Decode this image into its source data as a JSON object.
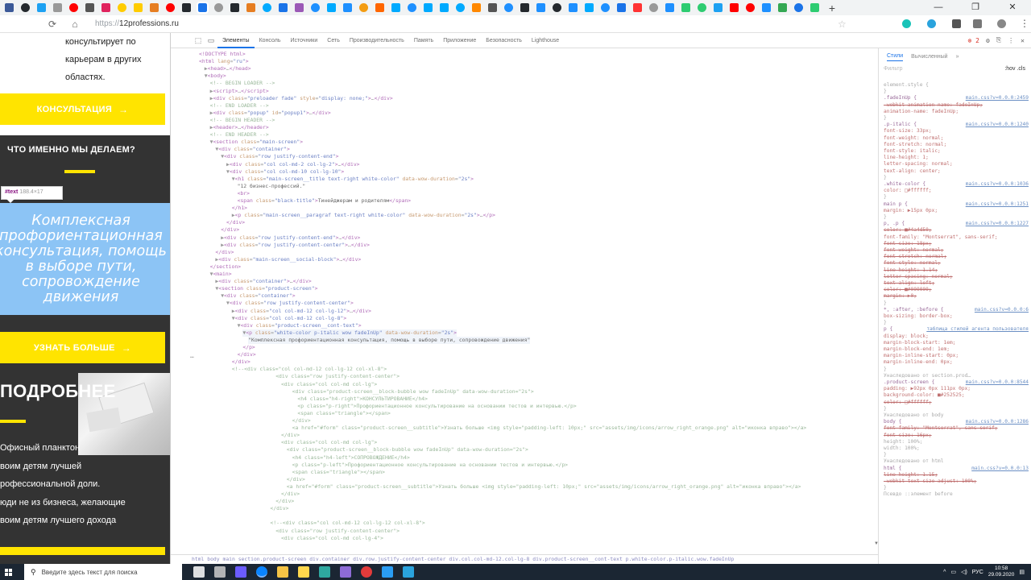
{
  "browser": {
    "url_scheme": "https://",
    "url_host": "12professions.ru",
    "tab_icon_colors": [
      "#3b5998",
      "#24292e",
      "#1da1f2",
      "#999999",
      "#ff0000",
      "#555555",
      "#e0245e",
      "#ffcc00",
      "#ffcc00",
      "#e67e22",
      "#ff0000",
      "#24292e",
      "#1a73e8",
      "#999999",
      "#24292e",
      "#e67e22",
      "#00aaff",
      "#1a73e8",
      "#9b59b6",
      "#1e90ff",
      "#00aaff",
      "#1e90ff",
      "#f39c12",
      "#ff6600",
      "#00aaff",
      "#1e90ff",
      "#00aaff",
      "#00aaff",
      "#00aaff",
      "#ff8800",
      "#555555",
      "#1e90ff",
      "#24292e",
      "#1e90ff",
      "#24292e",
      "#1e90ff",
      "#00aaff",
      "#1e90ff",
      "#1a73e8",
      "#ff3333",
      "#999999",
      "#1e90ff",
      "#2ecc71",
      "#2ecc71",
      "#1da1f2",
      "#ff0000",
      "#ff0000",
      "#1e90ff",
      "#34a853",
      "#1a73e8",
      "#2ecc71"
    ],
    "window_controls": [
      "—",
      "❐",
      "✕"
    ],
    "new_tab": "+"
  },
  "site": {
    "intro_text": "консультирует по карьерам в других областях.",
    "consult_button": "КОНСУЛЬТАЦИЯ",
    "what_we_do_title": "ЧТО ИМЕННО МЫ ДЕЛАЕМ?",
    "inspect_tooltip_tag": "#text",
    "inspect_tooltip_size": "188.4×17",
    "highlight_text": "Комплексная профориентационная консультация, помощь в выборе пути, сопровождение движения",
    "learn_more_button": "УЗНАТЬ БОЛЬШЕ",
    "details_title": "ПОДРОБНЕЕ",
    "details_lines": [
      "Офисный планктон",
      "воим детям лучшей",
      "рофессиональной доли.",
      "юди не из бизнеса, желающие",
      "воим детям лучшего дохода"
    ],
    "arrow": "→"
  },
  "devtools": {
    "tabs": [
      "Элементы",
      "Консоль",
      "Источники",
      "Сеть",
      "Производительность",
      "Память",
      "Приложение",
      "Безопасность",
      "Lighthouse"
    ],
    "active_tab": "Элементы",
    "error_count": "2",
    "dom_lines": [
      {
        "indent": 0,
        "html": "<span class='t'>&lt;!DOCTYPE html&gt;</span>"
      },
      {
        "indent": 0,
        "html": "<span class='t'>&lt;html</span> <span class='a'>lang</span>=<span class='v'>\"ru\"</span><span class='t'>&gt;</span>"
      },
      {
        "indent": 1,
        "html": "▶<span class='t'>&lt;head&gt;</span>…<span class='t'>&lt;/head&gt;</span>"
      },
      {
        "indent": 1,
        "html": "▼<span class='t'>&lt;body&gt;</span>"
      },
      {
        "indent": 2,
        "html": "<span class='c'>&lt;!-- BEGIN LOADER --&gt;</span>"
      },
      {
        "indent": 2,
        "html": "▶<span class='t'>&lt;script&gt;</span>…<span class='t'>&lt;/script&gt;</span>"
      },
      {
        "indent": 2,
        "html": "▶<span class='t'>&lt;div</span> <span class='a'>class</span>=<span class='v'>\"preloader fade\"</span> <span class='a'>style</span>=<span class='v'>\"display: none;\"</span><span class='t'>&gt;</span>…<span class='t'>&lt;/div&gt;</span>"
      },
      {
        "indent": 2,
        "html": "<span class='c'>&lt;!-- END LOADER --&gt;</span>"
      },
      {
        "indent": 2,
        "html": "▶<span class='t'>&lt;div</span> <span class='a'>class</span>=<span class='v'>\"popup\"</span> <span class='a'>id</span>=<span class='v'>\"popup1\"</span><span class='t'>&gt;</span>…<span class='t'>&lt;/div&gt;</span>"
      },
      {
        "indent": 2,
        "html": "<span class='c'>&lt;!-- BEGIN HEADER --&gt;</span>"
      },
      {
        "indent": 2,
        "html": "▶<span class='t'>&lt;header&gt;</span>…<span class='t'>&lt;/header&gt;</span>"
      },
      {
        "indent": 2,
        "html": "<span class='c'>&lt;!-- END HEADER --&gt;</span>"
      },
      {
        "indent": 2,
        "html": "▼<span class='t'>&lt;section</span> <span class='a'>class</span>=<span class='v'>\"main-screen\"</span><span class='t'>&gt;</span>"
      },
      {
        "indent": 3,
        "html": "▼<span class='t'>&lt;div</span> <span class='a'>class</span>=<span class='v'>\"container\"</span><span class='t'>&gt;</span>"
      },
      {
        "indent": 4,
        "html": "▼<span class='t'>&lt;div</span> <span class='a'>class</span>=<span class='v'>\"row justify-content-end\"</span><span class='t'>&gt;</span>"
      },
      {
        "indent": 5,
        "html": "▶<span class='t'>&lt;div</span> <span class='a'>class</span>=<span class='v'>\"col col-md-2 col-lg-2\"</span><span class='t'>&gt;</span>…<span class='t'>&lt;/div&gt;</span>"
      },
      {
        "indent": 5,
        "html": "▼<span class='t'>&lt;div</span> <span class='a'>class</span>=<span class='v'>\"col col-md-10 col-lg-10\"</span><span class='t'>&gt;</span>"
      },
      {
        "indent": 6,
        "html": "▼<span class='t'>&lt;h1</span> <span class='a'>class</span>=<span class='v'>\"main-screen__title text-right white-color\"</span> <span class='a'>data-wow-duration</span>=<span class='v'>\"2s\"</span><span class='t'>&gt;</span>"
      },
      {
        "indent": 7,
        "html": "<span class='tx'>\"12 бизнес-профессий.\"</span>"
      },
      {
        "indent": 7,
        "html": "<span class='t'>&lt;br&gt;</span>"
      },
      {
        "indent": 7,
        "html": "<span class='t'>&lt;span</span> <span class='a'>class</span>=<span class='v'>\"black-title\"</span><span class='t'>&gt;</span><span class='tx'>Тинейджерам и родителям</span><span class='t'>&lt;/span&gt;</span>"
      },
      {
        "indent": 6,
        "html": "<span class='t'>&lt;/h1&gt;</span>"
      },
      {
        "indent": 6,
        "html": "▶<span class='t'>&lt;p</span> <span class='a'>class</span>=<span class='v'>\"main-screen__paragraf text-right white-color\"</span> <span class='a'>data-wow-duration</span>=<span class='v'>\"2s\"</span><span class='t'>&gt;</span>…<span class='t'>&lt;/p&gt;</span>"
      },
      {
        "indent": 5,
        "html": "<span class='t'>&lt;/div&gt;</span>"
      },
      {
        "indent": 4,
        "html": "<span class='t'>&lt;/div&gt;</span>"
      },
      {
        "indent": 4,
        "html": "▶<span class='t'>&lt;div</span> <span class='a'>class</span>=<span class='v'>\"row justify-content-end\"</span><span class='t'>&gt;</span>…<span class='t'>&lt;/div&gt;</span>"
      },
      {
        "indent": 4,
        "html": "▶<span class='t'>&lt;div</span> <span class='a'>class</span>=<span class='v'>\"row justify-content-center\"</span><span class='t'>&gt;</span>…<span class='t'>&lt;/div&gt;</span>"
      },
      {
        "indent": 3,
        "html": "<span class='t'>&lt;/div&gt;</span>"
      },
      {
        "indent": 3,
        "html": "▶<span class='t'>&lt;div</span> <span class='a'>class</span>=<span class='v'>\"main-screen__social-block\"</span><span class='t'>&gt;</span>…<span class='t'>&lt;/div&gt;</span>"
      },
      {
        "indent": 2,
        "html": "<span class='t'>&lt;/section&gt;</span>"
      },
      {
        "indent": 2,
        "html": "▼<span class='t'>&lt;main&gt;</span>"
      },
      {
        "indent": 3,
        "html": "▶<span class='t'>&lt;div</span> <span class='a'>class</span>=<span class='v'>\"container\"</span><span class='t'>&gt;</span>…<span class='t'>&lt;/div&gt;</span>"
      },
      {
        "indent": 3,
        "html": "▼<span class='t'>&lt;section</span> <span class='a'>class</span>=<span class='v'>\"product-screen\"</span><span class='t'>&gt;</span>"
      },
      {
        "indent": 4,
        "html": "▼<span class='t'>&lt;div</span> <span class='a'>class</span>=<span class='v'>\"container\"</span><span class='t'>&gt;</span>"
      },
      {
        "indent": 5,
        "html": "▼<span class='t'>&lt;div</span> <span class='a'>class</span>=<span class='v'>\"row justify-content-center\"</span><span class='t'>&gt;</span>"
      },
      {
        "indent": 6,
        "html": "▶<span class='t'>&lt;div</span> <span class='a'>class</span>=<span class='v'>\"col col-md-12 col-lg-12\"</span><span class='t'>&gt;</span>…<span class='t'>&lt;/div&gt;</span>"
      },
      {
        "indent": 6,
        "html": "▼<span class='t'>&lt;div</span> <span class='a'>class</span>=<span class='v'>\"col col-md-12 col-lg-8\"</span><span class='t'>&gt;</span>"
      },
      {
        "indent": 7,
        "html": "▼<span class='t'>&lt;div</span> <span class='a'>class</span>=<span class='v'>\"product-screen__cont-text\"</span><span class='t'>&gt;</span>"
      },
      {
        "indent": 8,
        "html": "▼<span class='t'>&lt;p</span> <span class='a'>class</span>=<span class='v'>\"white-color p-italic wow fadeInUp\"</span> <span class='a'>data-wow-duration</span>=<span class='v'>\"2s\"</span><span class='t'>&gt;</span>",
        "sel": true
      },
      {
        "indent": 9,
        "html": "<span class='tx'>\"Комплексная профориентационная консультация, помощь в выборе пути, сопровождение движения\"</span>",
        "sel": true
      },
      {
        "indent": 8,
        "html": "<span class='t'>&lt;/p&gt;</span>"
      },
      {
        "indent": 7,
        "html": "<span class='t'>&lt;/div&gt;</span>"
      },
      {
        "indent": 6,
        "html": "<span class='t'>&lt;/div&gt;</span>"
      },
      {
        "indent": 6,
        "html": "<span class='c'>&lt;!--&lt;div class=\"col col-md-12 col-lg-12 col-xl-8\"&gt;</span>"
      },
      {
        "indent": 14,
        "html": "<span class='c'>&lt;div class=\"row justify-content-center\"&gt;</span>"
      },
      {
        "indent": 15,
        "html": "<span class='c'>&lt;div class=\"col col-md col-lg\"&gt;</span>"
      },
      {
        "indent": 17,
        "html": "<span class='c'>&lt;div class=\"product-screen__block-bubble wow fadeInUp\" data-wow-duration=\"2s\"&gt;</span>"
      },
      {
        "indent": 18,
        "html": "<span class='c'>&lt;h4 class=\"h4-right\"&gt;КОНСУЛЬТИРОВАНИЕ&lt;/h4&gt;</span>"
      },
      {
        "indent": 18,
        "html": "<span class='c'>&lt;p class=\"p-right\"&gt;Профориентационное консультирование на основании тестов и интервью.&lt;/p&gt;</span>"
      },
      {
        "indent": 18,
        "html": "<span class='c'>&lt;span class=\"triangle\"&gt;&lt;/span&gt;</span>"
      },
      {
        "indent": 17,
        "html": "<span class='c'>&lt;/div&gt;</span>"
      },
      {
        "indent": 17,
        "html": "<span class='c'>&lt;a  href=\"#form\" class=\"product-screen__subtitle\"&gt;Узнать больше &lt;img style=\"padding-left: 10px;\" src=\"assets/img/icons/arrow_right_orange.png\" alt=\"иконка вправо\"&gt;&lt;/a&gt;</span>"
      },
      {
        "indent": 15,
        "html": "<span class='c'>&lt;/div&gt;</span>"
      },
      {
        "indent": 15,
        "html": "<span class='c'>&lt;div class=\"col col-md col-lg\"&gt;</span>"
      },
      {
        "indent": 16,
        "html": "<span class='c'>&lt;div class=\"product-screen__block-bubble wow fadeInUp\" data-wow-duration=\"2s\"&gt;</span>"
      },
      {
        "indent": 17,
        "html": "<span class='c'>&lt;h4 class=\"h4-left\"&gt;СОПРОВОЖДЕНИЕ&lt;/h4&gt;</span>"
      },
      {
        "indent": 17,
        "html": "<span class='c'>&lt;p class=\"p-left\"&gt;Профориентационное консультирование на основании тестов и интервью.&lt;/p&gt;</span>"
      },
      {
        "indent": 17,
        "html": "<span class='c'>&lt;span class=\"triangle\"&gt;&lt;/span&gt;</span>"
      },
      {
        "indent": 16,
        "html": "<span class='c'>&lt;/div&gt;</span>"
      },
      {
        "indent": 16,
        "html": "<span class='c'>&lt;a  href=\"#form\" class=\"product-screen__subtitle\"&gt;Узнать больше &lt;img style=\"padding-left: 10px;\" src=\"assets/img/icons/arrow_right_orange.png\" alt=\"иконка вправо\"&gt;&lt;/a&gt;</span>"
      },
      {
        "indent": 15,
        "html": "<span class='c'>&lt;/div&gt;</span>"
      },
      {
        "indent": 14,
        "html": "<span class='c'>&lt;/div&gt;</span>"
      },
      {
        "indent": 13,
        "html": "<span class='c'>&lt;/div&gt;</span>"
      },
      {
        "indent": 0,
        "html": ""
      },
      {
        "indent": 13,
        "html": "<span class='c'>&lt;!--&lt;div class=\"col col-md-12 col-lg-12 col-xl-8\"&gt;</span>"
      },
      {
        "indent": 14,
        "html": "<span class='c'>&lt;div class=\"row justify-content-center\"&gt;</span>"
      },
      {
        "indent": 15,
        "html": "<span class='c'>&lt;div class=\"col col-md col-lg-4\"&gt;</span>"
      }
    ],
    "breadcrumb": "html  body  main  section.product-screen  div.container  div.row.justify-content-center  div.col.col-md-12.col-lg-8  div.product-screen__cont-text  p.white-color.p-italic.wow.fadeInUp",
    "styles_tabs": [
      "Стили",
      "Вычисленный"
    ],
    "filter_placeholder": "Фильтр",
    "hov_cls": ":hov  .cls",
    "style_lines": [
      {
        "text": "element.style {",
        "cls": "hd",
        "src": ""
      },
      {
        "text": "}",
        "cls": "hd",
        "src": ""
      },
      {
        "text": ".fadeInUp {",
        "cls": "sel",
        "src": "main.css?v=0.0.0:2459"
      },
      {
        "text": "  -webkit-animation-name: fadeInUp;",
        "cls": "prop strike",
        "src": ""
      },
      {
        "text": "  animation-name: fadeInUp;",
        "cls": "prop",
        "src": ""
      },
      {
        "text": "}",
        "cls": "hd",
        "src": ""
      },
      {
        "text": ".p-italic {",
        "cls": "sel",
        "src": "main.css?v=0.0.0:1240"
      },
      {
        "text": "  font-size: 33px;",
        "cls": "prop",
        "src": ""
      },
      {
        "text": "  font-weight: normal;",
        "cls": "prop",
        "src": ""
      },
      {
        "text": "  font-stretch: normal;",
        "cls": "prop",
        "src": ""
      },
      {
        "text": "  font-style: italic;",
        "cls": "prop",
        "src": ""
      },
      {
        "text": "  line-height: 1;",
        "cls": "prop",
        "src": ""
      },
      {
        "text": "  letter-spacing: normal;",
        "cls": "prop",
        "src": ""
      },
      {
        "text": "  text-align: center;",
        "cls": "prop",
        "src": ""
      },
      {
        "text": "}",
        "cls": "hd",
        "src": ""
      },
      {
        "text": ".white-color {",
        "cls": "sel",
        "src": "main.css?v=0.0.0:1036"
      },
      {
        "text": "  color: □#ffffff;",
        "cls": "prop",
        "src": ""
      },
      {
        "text": "}",
        "cls": "hd",
        "src": ""
      },
      {
        "text": "main p {",
        "cls": "sel",
        "src": "main.css?v=0.0.0:1251"
      },
      {
        "text": "  margin: ▶15px 0px;",
        "cls": "prop",
        "src": ""
      },
      {
        "text": "}",
        "cls": "hd",
        "src": ""
      },
      {
        "text": "p, .p {",
        "cls": "sel",
        "src": "main.css?v=0.0.0:1227"
      },
      {
        "text": "  color: ■#4a4d50;",
        "cls": "prop strike",
        "src": ""
      },
      {
        "text": "  font-family: \"Montserrat\", sans-serif;",
        "cls": "prop",
        "src": ""
      },
      {
        "text": "  font-size: 18px;",
        "cls": "prop strike",
        "src": ""
      },
      {
        "text": "  font-weight: normal;",
        "cls": "prop strike",
        "src": ""
      },
      {
        "text": "  font-stretch: normal;",
        "cls": "prop strike",
        "src": ""
      },
      {
        "text": "  font-style: normal;",
        "cls": "prop strike",
        "src": ""
      },
      {
        "text": "  line-height: 1.14;",
        "cls": "prop strike",
        "src": ""
      },
      {
        "text": "  letter-spacing: normal;",
        "cls": "prop strike",
        "src": ""
      },
      {
        "text": "  text-align: left;",
        "cls": "prop strike",
        "src": ""
      },
      {
        "text": "  color: ■#000000;",
        "cls": "prop strike",
        "src": ""
      },
      {
        "text": "  margin: ▶0;",
        "cls": "prop strike",
        "src": ""
      },
      {
        "text": "}",
        "cls": "hd",
        "src": ""
      },
      {
        "text": "*, :after, :before {",
        "cls": "sel",
        "src": "main.css?v=0.0.0:6"
      },
      {
        "text": "  box-sizing: border-box;",
        "cls": "prop",
        "src": ""
      },
      {
        "text": "}",
        "cls": "hd",
        "src": ""
      },
      {
        "text": "p {",
        "cls": "sel",
        "src": "таблица стилей агента пользователя"
      },
      {
        "text": "  display: block;",
        "cls": "prop",
        "src": ""
      },
      {
        "text": "  margin-block-start: 1em;",
        "cls": "prop",
        "src": ""
      },
      {
        "text": "  margin-block-end: 1em;",
        "cls": "prop",
        "src": ""
      },
      {
        "text": "  margin-inline-start: 0px;",
        "cls": "prop",
        "src": ""
      },
      {
        "text": "  margin-inline-end: 0px;",
        "cls": "prop",
        "src": ""
      },
      {
        "text": "}",
        "cls": "hd",
        "src": ""
      },
      {
        "text": "Унаследовано от section.prod…",
        "cls": "hd",
        "src": ""
      },
      {
        "text": ".product-screen {",
        "cls": "sel",
        "src": "main.css?v=0.0.0:8544"
      },
      {
        "text": "  padding: ▶92px 0px 111px 0px;",
        "cls": "prop",
        "src": ""
      },
      {
        "text": "  background-color: ■#252525;",
        "cls": "prop",
        "src": ""
      },
      {
        "text": "  color: □#ffffff;",
        "cls": "prop strike",
        "src": ""
      },
      {
        "text": "}",
        "cls": "hd",
        "src": ""
      },
      {
        "text": "Унаследовано от body",
        "cls": "hd",
        "src": ""
      },
      {
        "text": "body {",
        "cls": "sel",
        "src": "main.css?v=0.0.0:1286"
      },
      {
        "text": "  font-family: \"Montserrat\", sans-serif;",
        "cls": "prop strike",
        "src": ""
      },
      {
        "text": "  font-size: 16px;",
        "cls": "prop strike",
        "src": ""
      },
      {
        "text": "  height: 100%;",
        "cls": "hd",
        "src": ""
      },
      {
        "text": "  width: 100%;",
        "cls": "hd",
        "src": ""
      },
      {
        "text": "}",
        "cls": "hd",
        "src": ""
      },
      {
        "text": "Унаследовано от html",
        "cls": "hd",
        "src": ""
      },
      {
        "text": "html {",
        "cls": "sel",
        "src": "main.css?v=0.0.0:13"
      },
      {
        "text": "  line-height: 1.15;",
        "cls": "prop strike",
        "src": ""
      },
      {
        "text": "  -webkit-text-size-adjust: 100%;",
        "cls": "prop strike",
        "src": ""
      },
      {
        "text": "}",
        "cls": "hd",
        "src": ""
      },
      {
        "text": "Псевдо ::элемент before",
        "cls": "hd",
        "src": ""
      }
    ]
  },
  "taskbar": {
    "search_placeholder": "Введите здесь текст для поиска",
    "icon_colors": [
      "#ffffff",
      "#cccccc",
      "#6b5cff",
      "#0a84ff",
      "#f6c445",
      "#ffd84d",
      "#2ea8a0",
      "#8d6bd6",
      "#e33b3b",
      "#2a9df4",
      "#2aa3dd"
    ],
    "lang": "РУС",
    "time": "10:58",
    "date": "29.09.2020"
  }
}
